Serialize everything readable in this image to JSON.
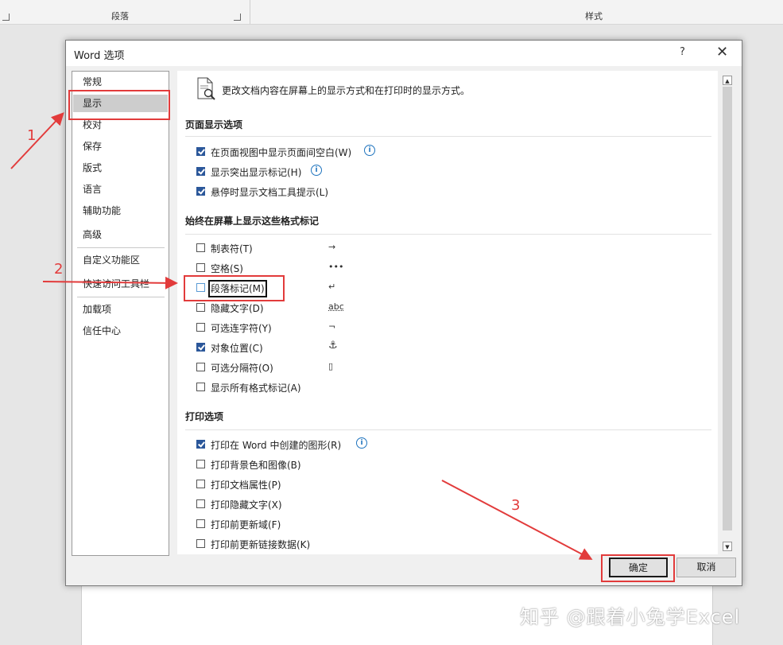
{
  "ribbon": {
    "group1": "段落",
    "group2": "样式"
  },
  "dialog": {
    "title": "Word 选项",
    "help": "?",
    "close": "✕"
  },
  "nav": {
    "items": [
      {
        "label": "常规",
        "selected": false
      },
      {
        "label": "显示",
        "selected": true
      },
      {
        "label": "校对",
        "selected": false
      },
      {
        "label": "保存",
        "selected": false
      },
      {
        "label": "版式",
        "selected": false
      },
      {
        "label": "语言",
        "selected": false
      },
      {
        "label": "辅助功能",
        "selected": false
      },
      {
        "label": "高级",
        "selected": false
      },
      {
        "label": "自定义功能区",
        "selected": false
      },
      {
        "label": "快速访问工具栏",
        "selected": false
      },
      {
        "label": "加载项",
        "selected": false
      },
      {
        "label": "信任中心",
        "selected": false
      }
    ]
  },
  "content": {
    "description": "更改文档内容在屏幕上的显示方式和在打印时的显示方式。",
    "page_display": {
      "title": "页面显示选项",
      "options": [
        {
          "label": "在页面视图中显示页面间空白(W)",
          "checked": true
        },
        {
          "label": "显示突出显示标记(H)",
          "checked": true
        },
        {
          "label": "悬停时显示文档工具提示(L)",
          "checked": true
        }
      ]
    },
    "format_marks": {
      "title": "始终在屏幕上显示这些格式标记",
      "options": [
        {
          "label": "制表符(T)",
          "checked": false,
          "symbol": "→"
        },
        {
          "label": "空格(S)",
          "checked": false,
          "symbol": "•••"
        },
        {
          "label": "段落标记(M)",
          "checked": false,
          "symbol": "↵"
        },
        {
          "label": "隐藏文字(D)",
          "checked": false,
          "symbol": "abc"
        },
        {
          "label": "可选连字符(Y)",
          "checked": false,
          "symbol": "¬"
        },
        {
          "label": "对象位置(C)",
          "checked": true,
          "symbol": "⚓"
        },
        {
          "label": "可选分隔符(O)",
          "checked": false,
          "symbol": "▯"
        },
        {
          "label": "显示所有格式标记(A)",
          "checked": false,
          "symbol": ""
        }
      ]
    },
    "print": {
      "title": "打印选项",
      "options": [
        {
          "label": "打印在 Word 中创建的图形(R)",
          "checked": true
        },
        {
          "label": "打印背景色和图像(B)",
          "checked": false
        },
        {
          "label": "打印文档属性(P)",
          "checked": false
        },
        {
          "label": "打印隐藏文字(X)",
          "checked": false
        },
        {
          "label": "打印前更新域(F)",
          "checked": false
        },
        {
          "label": "打印前更新链接数据(K)",
          "checked": false
        }
      ]
    }
  },
  "buttons": {
    "ok": "确定",
    "cancel": "取消"
  },
  "annotations": {
    "n1": "1",
    "n2": "2",
    "n3": "3",
    "color": "#e23b3b"
  },
  "watermark": "知乎 @跟着小兔学Excel"
}
